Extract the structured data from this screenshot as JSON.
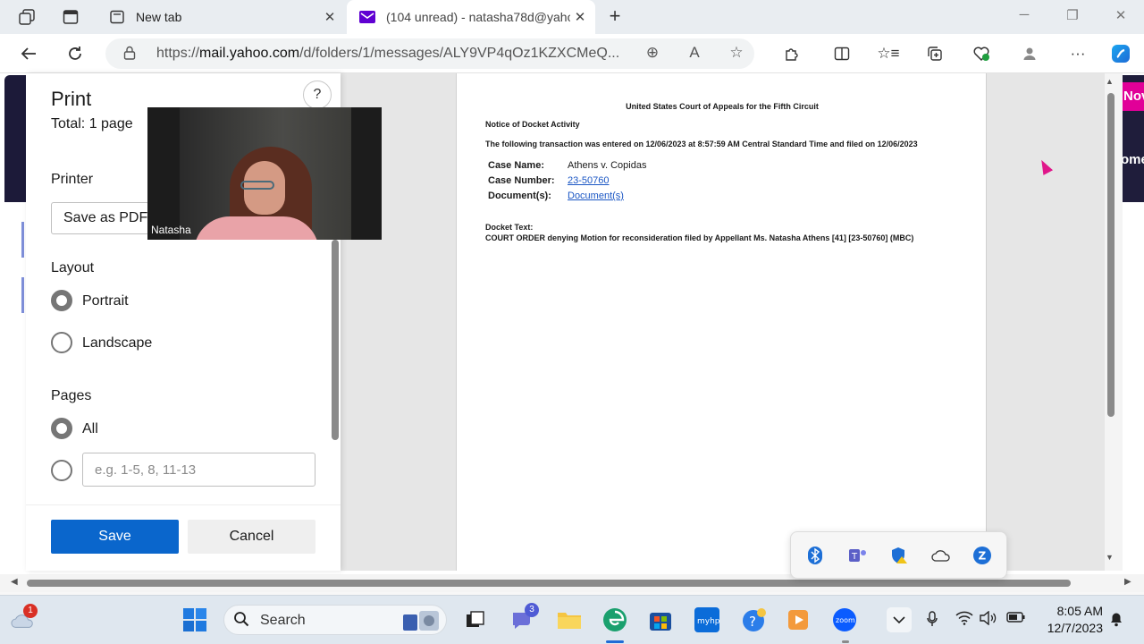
{
  "browser": {
    "tabs": [
      {
        "title": "New tab",
        "favicon": "new-tab-icon"
      },
      {
        "title": "(104 unread) - natasha78d@yahoo",
        "favicon": "yahoo-mail-icon",
        "active": true
      }
    ],
    "url_prefix": "https://",
    "url_domain": "mail.yahoo.com",
    "url_rest": "/d/folders/1/messages/ALY9VP4qOz1KZXCMeQ..."
  },
  "print": {
    "title": "Print",
    "total": "Total: 1 page",
    "help": "?",
    "printer_label": "Printer",
    "printer_value": "Save as PDF",
    "layout_label": "Layout",
    "layout_options": [
      "Portrait",
      "Landscape"
    ],
    "layout_selected": "Portrait",
    "pages_label": "Pages",
    "pages_options": [
      "All"
    ],
    "pages_selected": "All",
    "range_placeholder": "e.g. 1-5, 8, 11-13",
    "save": "Save",
    "cancel": "Cancel"
  },
  "document": {
    "court": "United States Court of Appeals for the Fifth Circuit",
    "notice": "Notice of Docket Activity",
    "transaction": "The following transaction was entered on 12/06/2023 at 8:57:59 AM Central Standard Time and filed on 12/06/2023",
    "case_name_label": "Case Name:",
    "case_name": "Athens v. Copidas",
    "case_number_label": "Case Number:",
    "case_number": "23-50760",
    "documents_label": "Document(s):",
    "documents": "Document(s)",
    "docket_label": "Docket Text:",
    "docket_text": "COURT ORDER denying Motion for reconsideration filed by Appellant Ms. Natasha Athens [41] [23-50760] (MBC)"
  },
  "video": {
    "participant": "Natasha"
  },
  "background_page": {
    "right_banner_top": "Nov",
    "right_banner_bottom": "ome"
  },
  "taskbar": {
    "search": "Search",
    "weather_badge": "1",
    "chat_badge": "3",
    "time": "8:05 AM",
    "date": "12/7/2023"
  },
  "colors": {
    "accent": "#0a66cc",
    "yahoo": "#6001d2",
    "link": "#1a56c4",
    "banner_pink": "#e10098",
    "banner_dark": "#1f1d3b"
  }
}
